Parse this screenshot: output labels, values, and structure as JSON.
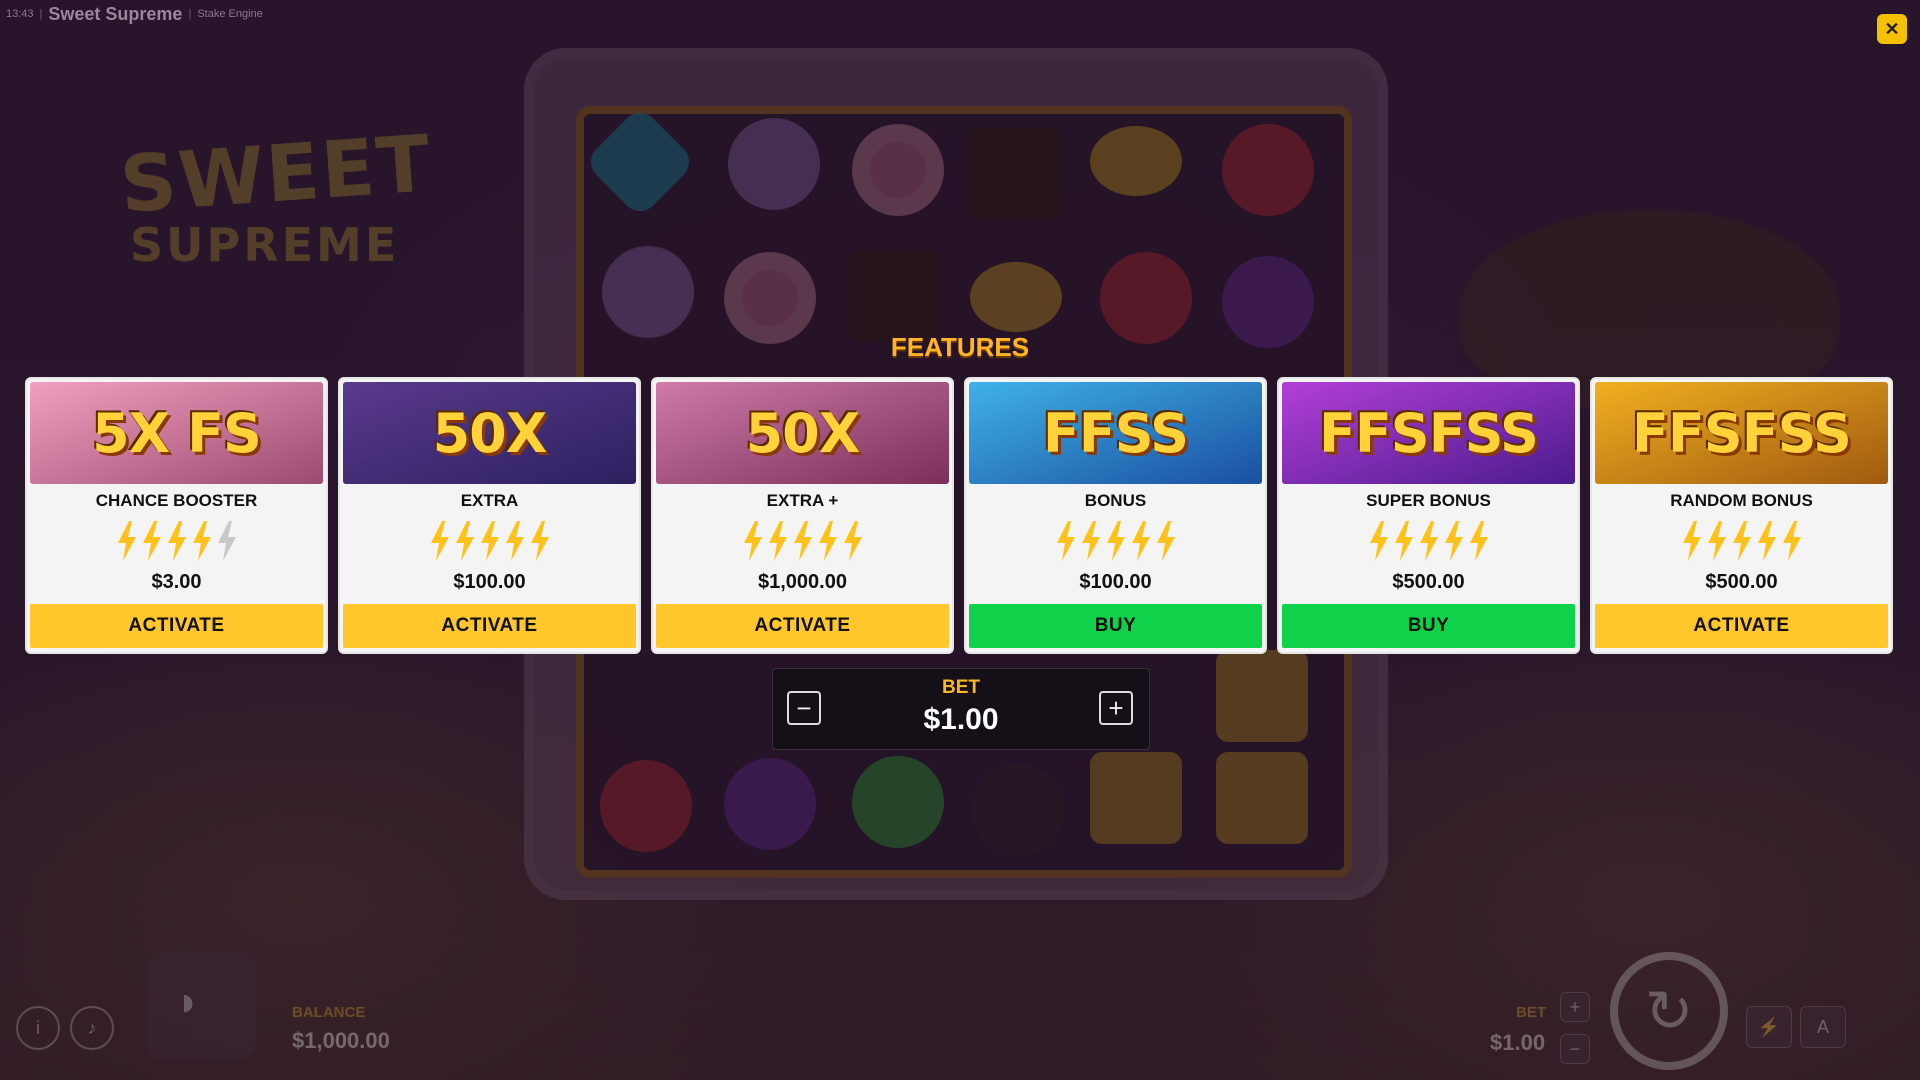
{
  "topbar": {
    "time": "13:43",
    "title": "Sweet Supreme",
    "provider": "Stake Engine"
  },
  "close_icon": "close-icon",
  "logo": {
    "line1": "SWEET",
    "line2": "SUPREME"
  },
  "features_title": "FEATURES",
  "cards": [
    {
      "name": "CHANCE BOOSTER",
      "price": "$3.00",
      "action": "ACTIVATE",
      "action_color": "#ffc72c",
      "rating": 4,
      "art_text": "5X FS",
      "art_colors": [
        "#f29fc0",
        "#9c4b70"
      ]
    },
    {
      "name": "EXTRA",
      "price": "$100.00",
      "action": "ACTIVATE",
      "action_color": "#ffc72c",
      "rating": 5,
      "art_text": "50X",
      "art_colors": [
        "#5a3a8c",
        "#2c2060"
      ]
    },
    {
      "name": "EXTRA +",
      "price": "$1,000.00",
      "action": "ACTIVATE",
      "action_color": "#ffc72c",
      "rating": 5,
      "art_text": "50X",
      "art_colors": [
        "#d07aa8",
        "#7a2f5a"
      ]
    },
    {
      "name": "BONUS",
      "price": "$100.00",
      "action": "BUY",
      "action_color": "#10d24a",
      "rating": 5,
      "art_text": "FFSS",
      "art_colors": [
        "#3fb2e8",
        "#1a4fa0"
      ]
    },
    {
      "name": "SUPER BONUS",
      "price": "$500.00",
      "action": "BUY",
      "action_color": "#10d24a",
      "rating": 5,
      "art_text": "FFSFSS",
      "art_colors": [
        "#b33fd8",
        "#4b1b8c"
      ]
    },
    {
      "name": "RANDOM BONUS",
      "price": "$500.00",
      "action": "ACTIVATE",
      "action_color": "#ffc72c",
      "rating": 5,
      "art_text": "FFSFSS",
      "art_colors": [
        "#f0b020",
        "#a05a10"
      ]
    }
  ],
  "bet_panel": {
    "label": "BET",
    "value": "$1.00",
    "minus": "−",
    "plus": "+"
  },
  "hud": {
    "balance_label": "BALANCE",
    "balance_value": "$1,000.00",
    "bet_label": "BET",
    "bet_value": "$1.00",
    "plus": "+",
    "minus": "−",
    "info_icon": "info-icon",
    "sound_icon": "sound-icon",
    "lightning_icon": "lightning-icon",
    "autoplay_icon": "autoplay-icon",
    "spin_icon": "spin-icon"
  },
  "colors": {
    "accent": "#ffb526",
    "activate": "#ffc72c",
    "buy": "#10d24a",
    "close": "#f5c000"
  }
}
